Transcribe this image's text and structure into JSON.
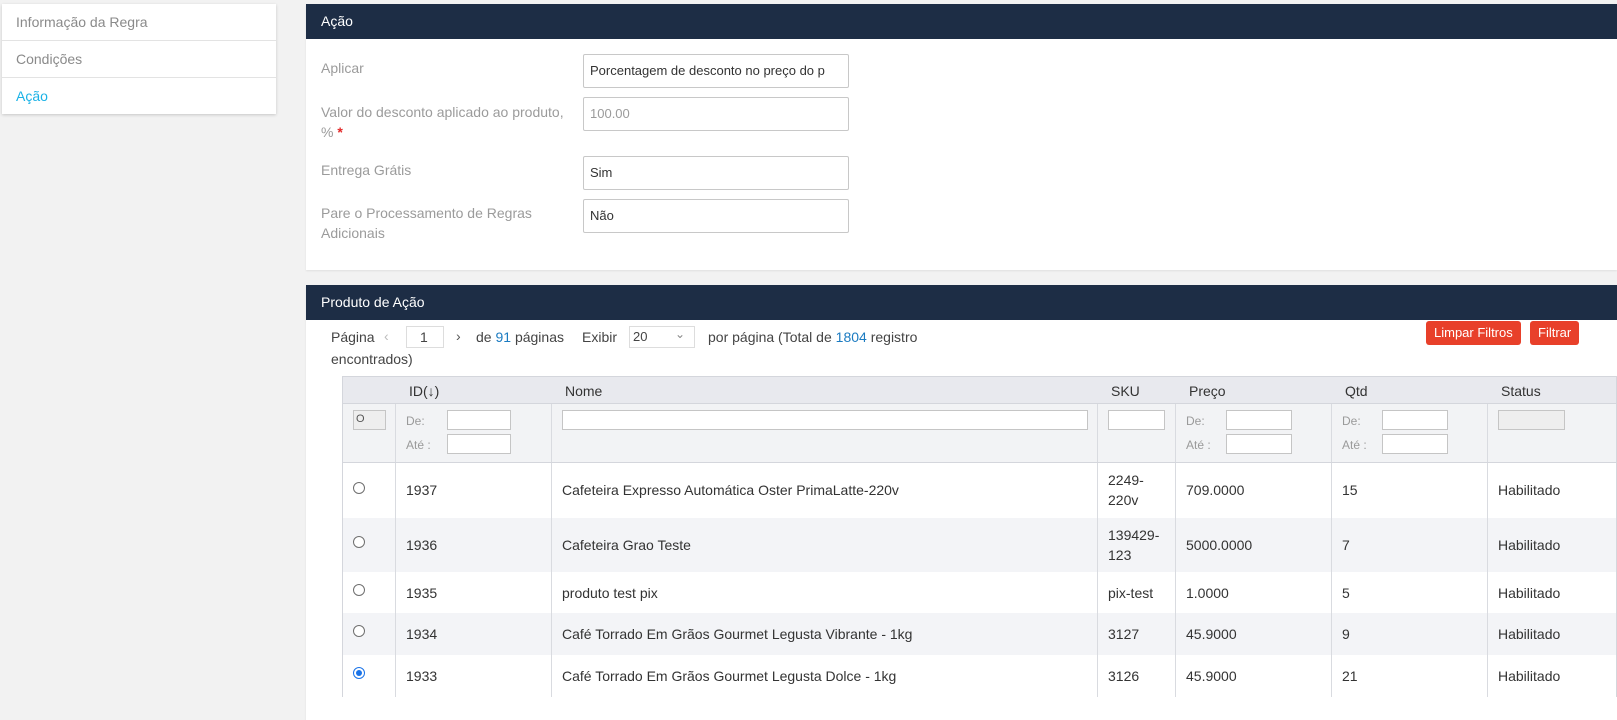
{
  "sidebar": {
    "items": [
      {
        "label": "Informação da Regra"
      },
      {
        "label": "Condições"
      },
      {
        "label": "Ação"
      }
    ]
  },
  "acao": {
    "title": "Ação",
    "fields": {
      "aplicar": {
        "label": "Aplicar",
        "value": "Porcentagem de desconto no preço do p"
      },
      "desconto": {
        "label": "Valor do desconto aplicado ao produto, %",
        "required": "*",
        "value": "100.00"
      },
      "entrega": {
        "label": "Entrega Grátis",
        "value": "Sim"
      },
      "pare": {
        "label": "Pare o Processamento de Regras Adicionais",
        "value": "Não"
      }
    }
  },
  "produto": {
    "title": "Produto de Ação",
    "pager": {
      "pagina_label": "Página",
      "prev_icon": "chevron-left-icon",
      "page": "1",
      "next_icon": "chevron-right-icon",
      "de": "de",
      "total_pages": "91",
      "paginas": "páginas",
      "exibir": "Exibir",
      "per_page": "20",
      "por_pagina": "por página (Total de",
      "total": "1804",
      "registro": "registro",
      "encontrados": "encontrados)"
    },
    "buttons": {
      "limpar": "Limpar Filtros",
      "filtrar": "Filtrar"
    },
    "columns": {
      "id": "ID",
      "sort_icon": "(↓)",
      "nome": "Nome",
      "sku": "SKU",
      "preco": "Preço",
      "qtd": "Qtd",
      "status": "Status"
    },
    "filters": {
      "select_value": "O",
      "de": "De:",
      "ate": "Até :"
    },
    "rows": [
      {
        "id": "1937",
        "nome": "Cafeteira Expresso Automática Oster PrimaLatte-220v",
        "sku1": "2249-",
        "sku2": "220v",
        "preco": "709.0000",
        "qtd": "15",
        "status": "Habilitado",
        "selected": false
      },
      {
        "id": "1936",
        "nome": "Cafeteira Grao Teste",
        "sku1": "139429-",
        "sku2": "123",
        "preco": "5000.0000",
        "qtd": "7",
        "status": "Habilitado",
        "selected": false
      },
      {
        "id": "1935",
        "nome": "produto test pix",
        "sku1": "pix-test",
        "preco": "1.0000",
        "qtd": "5",
        "status": "Habilitado",
        "selected": false
      },
      {
        "id": "1934",
        "nome": "Café Torrado Em Grãos Gourmet Legusta Vibrante - 1kg",
        "sku1": "3127",
        "preco": "45.9000",
        "qtd": "9",
        "status": "Habilitado",
        "selected": false
      },
      {
        "id": "1933",
        "nome": "Café Torrado Em Grãos Gourmet Legusta Dolce - 1kg",
        "sku1": "3126",
        "preco": "45.9000",
        "qtd": "21",
        "status": "Habilitado",
        "selected": true
      }
    ]
  },
  "colors": {
    "header_bg": "#1d2d45",
    "accent": "#1ab2e6",
    "button_red": "#e8402a",
    "required": "#e22626"
  }
}
